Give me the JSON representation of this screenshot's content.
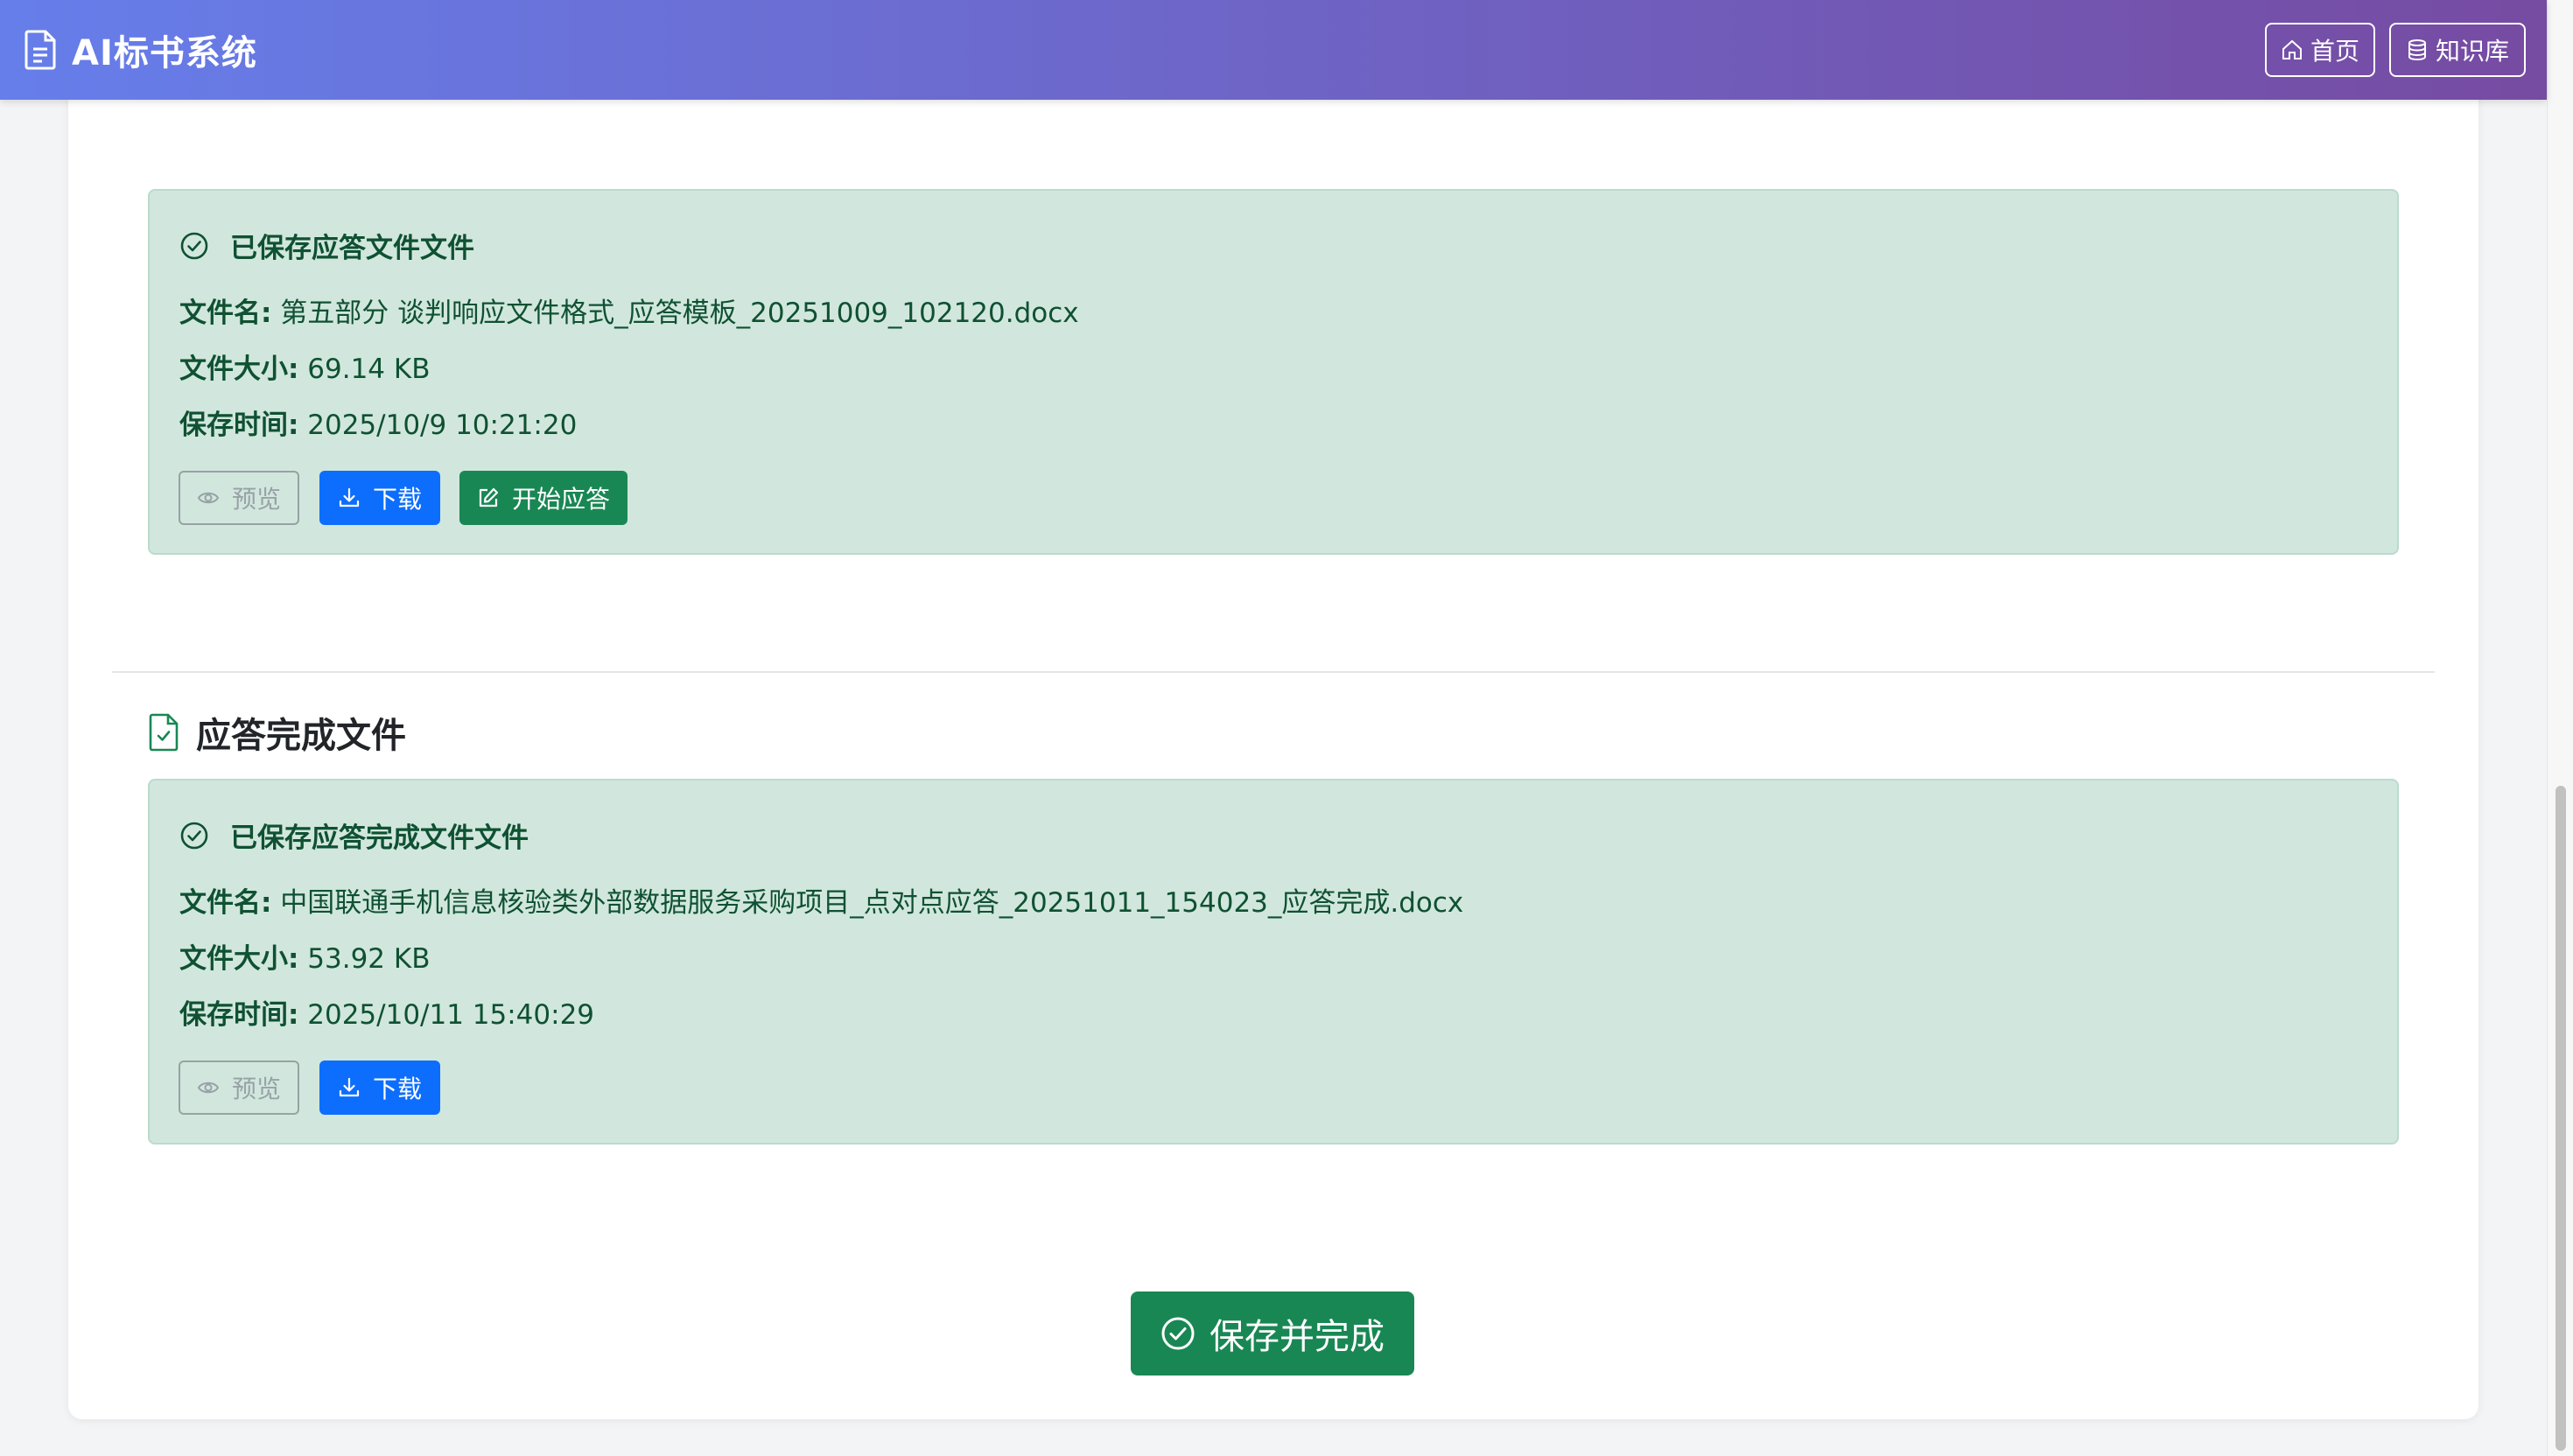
{
  "navbar": {
    "title": "AI标书系统",
    "home_label": "首页",
    "kb_label": "知识库"
  },
  "template_file": {
    "status_title": "已保存应答文件文件",
    "name_label": "文件名:",
    "name_value": "第五部分 谈判响应文件格式_应答模板_20251009_102120.docx",
    "size_label": "文件大小:",
    "size_value": "69.14 KB",
    "time_label": "保存时间:",
    "time_value": "2025/10/9 10:21:20",
    "preview_label": "预览",
    "download_label": "下载",
    "start_answer_label": "开始应答"
  },
  "completed_section": {
    "title": "应答完成文件"
  },
  "completed_file": {
    "status_title": "已保存应答完成文件文件",
    "name_label": "文件名:",
    "name_value": "中国联通手机信息核验类外部数据服务采购项目_点对点应答_20251011_154023_应答完成.docx",
    "size_label": "文件大小:",
    "size_value": "53.92 KB",
    "time_label": "保存时间:",
    "time_value": "2025/10/11 15:40:29",
    "preview_label": "预览",
    "download_label": "下载"
  },
  "footer": {
    "save_complete_label": "保存并完成"
  },
  "colors": {
    "nav_gradient_start": "#667eea",
    "nav_gradient_end": "#764ba2",
    "success_bg": "#d1e7dd",
    "success_text": "#0f5132",
    "primary": "#0d6efd",
    "success": "#198754"
  },
  "icons": {
    "brand": "file-text-icon",
    "home": "house-icon",
    "kb": "database-icon",
    "status": "check-circle-icon",
    "preview": "eye-icon",
    "download": "download-icon",
    "answer": "pencil-square-icon",
    "section": "file-check-icon",
    "save": "check-circle-icon"
  }
}
